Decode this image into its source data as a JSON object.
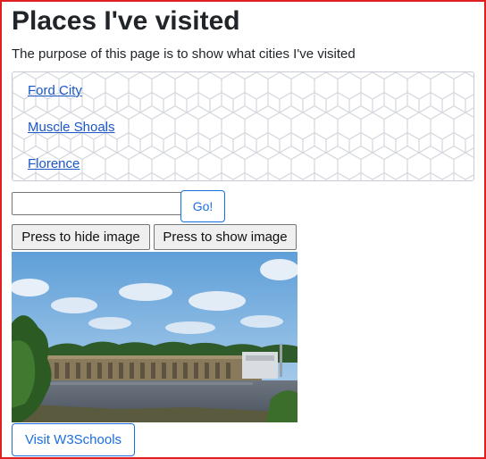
{
  "page": {
    "title": "Places I've visited",
    "description": "The purpose of this page is to show what cities I've visited"
  },
  "cities": [
    {
      "label": "Ford City"
    },
    {
      "label": "Muscle Shoals"
    },
    {
      "label": "Florence"
    }
  ],
  "search": {
    "value": "",
    "go_label": "Go!"
  },
  "image_controls": {
    "hide_label": "Press to hide image",
    "show_label": "Press to show image"
  },
  "photo": {
    "subject": "dam over river with trees"
  },
  "footer": {
    "visit_label": "Visit W3Schools"
  },
  "colors": {
    "accent": "#1a6fe0",
    "link": "#1a57c8",
    "frame_border": "#e02020"
  }
}
